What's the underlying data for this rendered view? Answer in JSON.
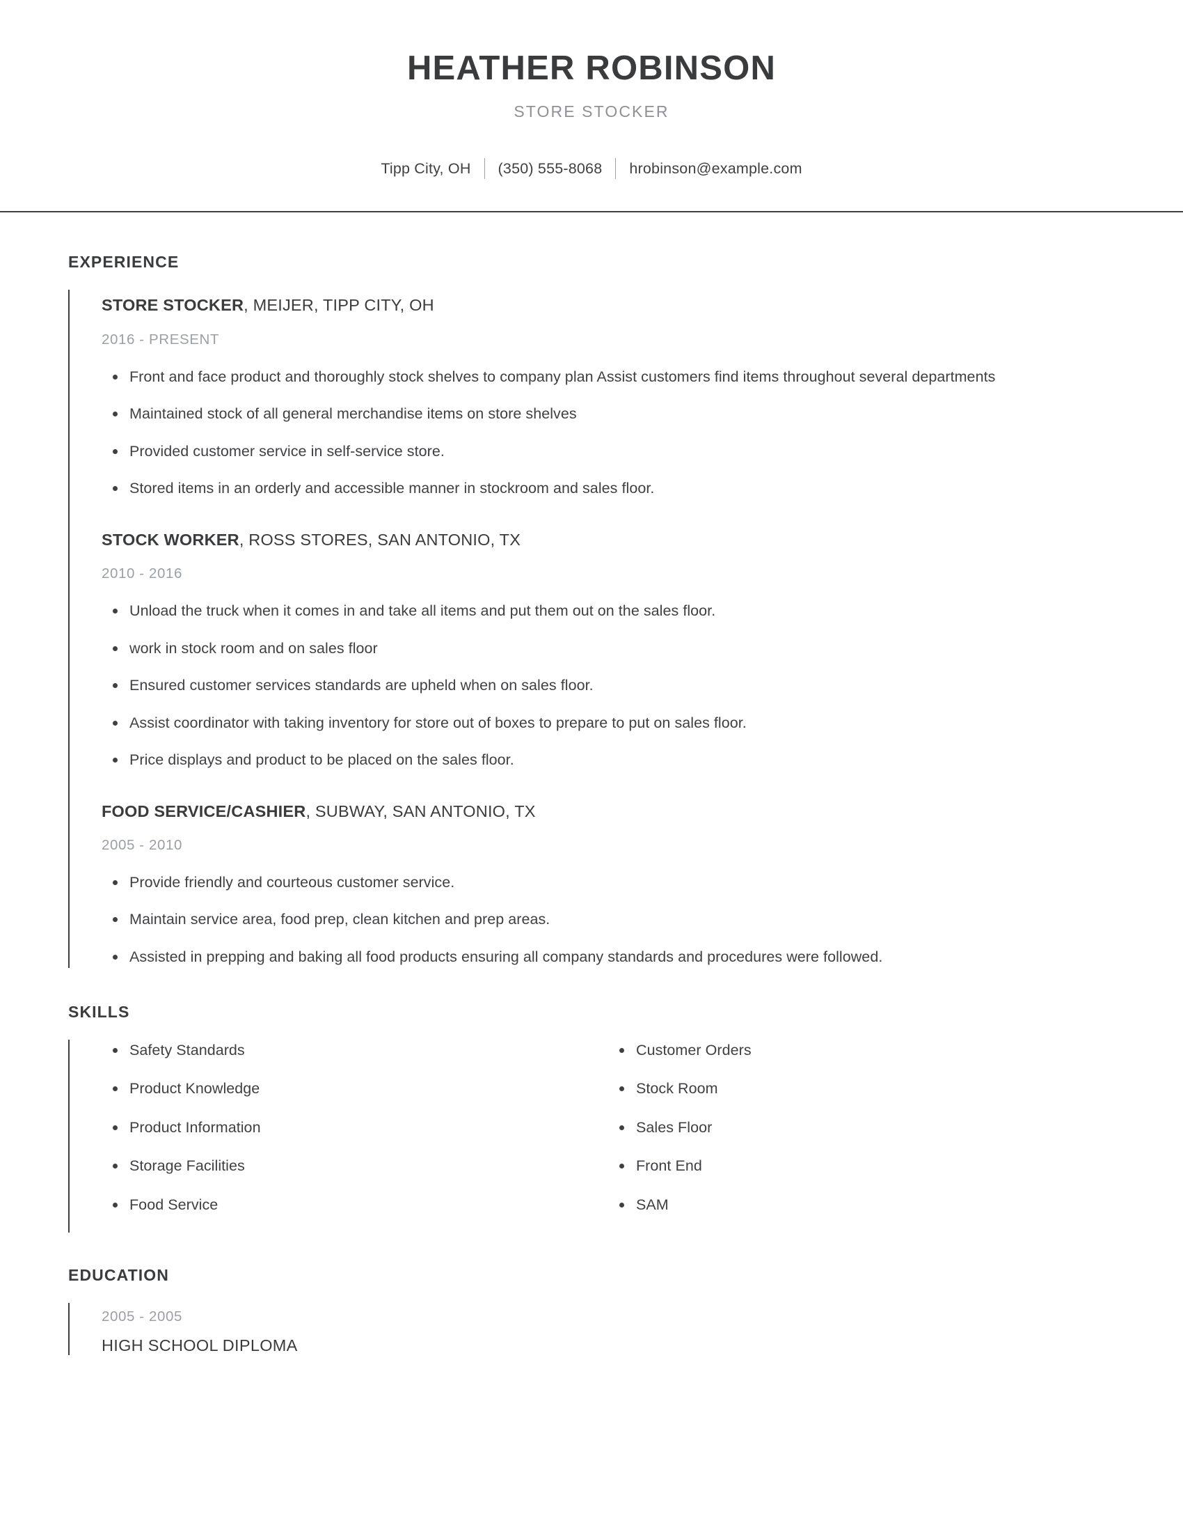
{
  "header": {
    "name": "HEATHER ROBINSON",
    "job_title": "STORE STOCKER",
    "contact": {
      "location": "Tipp City, OH",
      "phone": "(350) 555-8068",
      "email": "hrobinson@example.com"
    }
  },
  "experience": {
    "heading": "EXPERIENCE",
    "entries": [
      {
        "role": "STORE STOCKER",
        "org": ", MEIJER, TIPP CITY, OH",
        "date": "2016 - PRESENT",
        "bullets": [
          "Front and face product and thoroughly stock shelves to company plan Assist customers find items throughout several departments",
          "Maintained stock of all general merchandise items on store shelves",
          "Provided customer service in self-service store.",
          "Stored items in an orderly and accessible manner in stockroom and sales floor."
        ]
      },
      {
        "role": "STOCK WORKER",
        "org": ", ROSS STORES, SAN ANTONIO, TX",
        "date": "2010 - 2016",
        "bullets": [
          "Unload the truck when it comes in and take all items and put them out on the sales floor.",
          "work in stock room and on sales floor",
          "Ensured customer services standards are upheld when on sales floor.",
          "Assist coordinator with taking inventory for store out of boxes to prepare to put on sales floor.",
          "Price displays and product to be placed on the sales floor."
        ]
      },
      {
        "role": "FOOD SERVICE/CASHIER",
        "org": ", SUBWAY, SAN ANTONIO, TX",
        "date": "2005 - 2010",
        "bullets": [
          "Provide friendly and courteous customer service.",
          "Maintain service area, food prep, clean kitchen and prep areas.",
          "Assisted in prepping and baking all food products ensuring all company standards and procedures were followed."
        ]
      }
    ]
  },
  "skills": {
    "heading": "SKILLS",
    "column_left": [
      "Safety Standards",
      "Product Knowledge",
      "Product Information",
      "Storage Facilities",
      "Food Service"
    ],
    "column_right": [
      "Customer Orders",
      "Stock Room",
      "Sales Floor",
      "Front End",
      "SAM"
    ]
  },
  "education": {
    "heading": "EDUCATION",
    "entries": [
      {
        "date": "2005 - 2005",
        "degree": "HIGH SCHOOL DIPLOMA"
      }
    ]
  },
  "colors": {
    "text_dark": "#3a3b3d",
    "text_body": "#3f4043",
    "text_muted": "#9aa0a6",
    "rule": "#3f4043"
  }
}
